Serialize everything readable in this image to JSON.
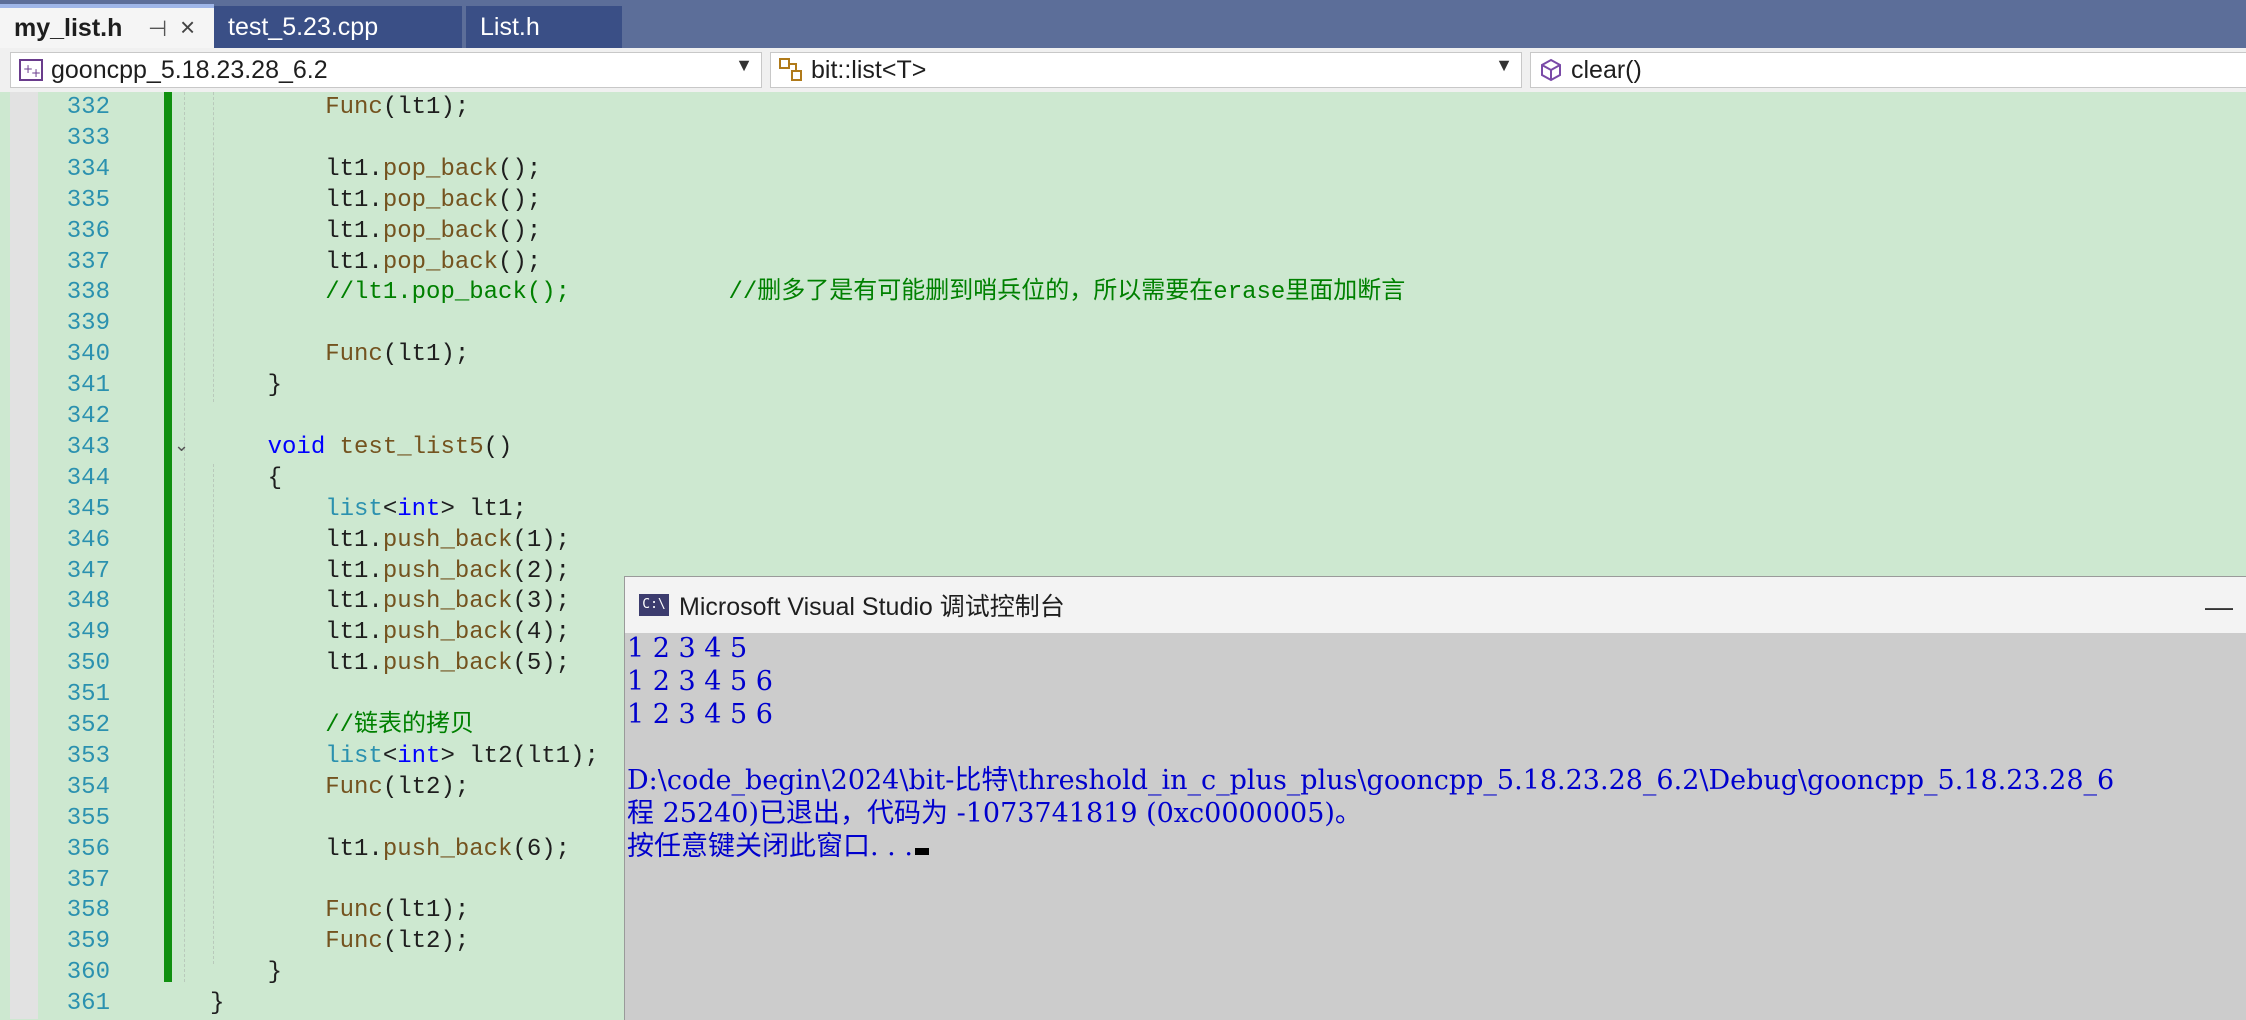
{
  "tabs": [
    {
      "label": "my_list.h",
      "active": true
    },
    {
      "label": "test_5.23.cpp",
      "active": false
    },
    {
      "label": "List.h",
      "active": false
    }
  ],
  "tab_icons": {
    "pin": "pin-icon",
    "close": "close-icon"
  },
  "navbar": {
    "project": "gooncpp_5.18.23.28_6.2",
    "scope": "bit::list<T>",
    "member": "clear()"
  },
  "editor": {
    "lines": [
      {
        "n": "332",
        "t": [
          [
            "        ",
            ""
          ],
          [
            "Func",
            "fn"
          ],
          [
            "(lt1);",
            ""
          ]
        ]
      },
      {
        "n": "333",
        "t": []
      },
      {
        "n": "334",
        "t": [
          [
            "        lt1.",
            ""
          ],
          [
            "pop_back",
            "fn"
          ],
          [
            "();",
            ""
          ]
        ]
      },
      {
        "n": "335",
        "t": [
          [
            "        lt1.",
            ""
          ],
          [
            "pop_back",
            "fn"
          ],
          [
            "();",
            ""
          ]
        ]
      },
      {
        "n": "336",
        "t": [
          [
            "        lt1.",
            ""
          ],
          [
            "pop_back",
            "fn"
          ],
          [
            "();",
            ""
          ]
        ]
      },
      {
        "n": "337",
        "t": [
          [
            "        lt1.",
            ""
          ],
          [
            "pop_back",
            "fn"
          ],
          [
            "();",
            ""
          ]
        ]
      },
      {
        "n": "338",
        "t": [
          [
            "        ",
            ""
          ],
          [
            "//lt1.pop_back();           //删多了是有可能删到哨兵位的，所以需要在erase里面加断言",
            "cm"
          ]
        ]
      },
      {
        "n": "339",
        "t": []
      },
      {
        "n": "340",
        "t": [
          [
            "        ",
            ""
          ],
          [
            "Func",
            "fn"
          ],
          [
            "(lt1);",
            ""
          ]
        ]
      },
      {
        "n": "341",
        "t": [
          [
            "    }",
            ""
          ]
        ]
      },
      {
        "n": "342",
        "t": []
      },
      {
        "n": "343",
        "t": [
          [
            "    ",
            ""
          ],
          [
            "void",
            "kw"
          ],
          [
            " ",
            ""
          ],
          [
            "test_list5",
            "fn"
          ],
          [
            "()",
            ""
          ]
        ]
      },
      {
        "n": "344",
        "t": [
          [
            "    {",
            ""
          ]
        ]
      },
      {
        "n": "345",
        "t": [
          [
            "        ",
            ""
          ],
          [
            "list",
            "ty"
          ],
          [
            "<",
            ""
          ],
          [
            "int",
            "kw"
          ],
          [
            "> lt1;",
            ""
          ]
        ]
      },
      {
        "n": "346",
        "t": [
          [
            "        lt1.",
            ""
          ],
          [
            "push_back",
            "fn"
          ],
          [
            "(1);",
            ""
          ]
        ]
      },
      {
        "n": "347",
        "t": [
          [
            "        lt1.",
            ""
          ],
          [
            "push_back",
            "fn"
          ],
          [
            "(2);",
            ""
          ]
        ]
      },
      {
        "n": "348",
        "t": [
          [
            "        lt1.",
            ""
          ],
          [
            "push_back",
            "fn"
          ],
          [
            "(3);",
            ""
          ]
        ]
      },
      {
        "n": "349",
        "t": [
          [
            "        lt1.",
            ""
          ],
          [
            "push_back",
            "fn"
          ],
          [
            "(4);",
            ""
          ]
        ]
      },
      {
        "n": "350",
        "t": [
          [
            "        lt1.",
            ""
          ],
          [
            "push_back",
            "fn"
          ],
          [
            "(5);",
            ""
          ]
        ]
      },
      {
        "n": "351",
        "t": []
      },
      {
        "n": "352",
        "t": [
          [
            "        ",
            ""
          ],
          [
            "//链表的拷贝",
            "cm"
          ]
        ]
      },
      {
        "n": "353",
        "t": [
          [
            "        ",
            ""
          ],
          [
            "list",
            "ty"
          ],
          [
            "<",
            ""
          ],
          [
            "int",
            "kw"
          ],
          [
            "> lt2(lt1);",
            ""
          ]
        ]
      },
      {
        "n": "354",
        "t": [
          [
            "        ",
            ""
          ],
          [
            "Func",
            "fn"
          ],
          [
            "(lt2);",
            ""
          ]
        ]
      },
      {
        "n": "355",
        "t": []
      },
      {
        "n": "356",
        "t": [
          [
            "        lt1.",
            ""
          ],
          [
            "push_back",
            "fn"
          ],
          [
            "(6);",
            ""
          ]
        ]
      },
      {
        "n": "357",
        "t": []
      },
      {
        "n": "358",
        "t": [
          [
            "        ",
            ""
          ],
          [
            "Func",
            "fn"
          ],
          [
            "(lt1);",
            ""
          ]
        ]
      },
      {
        "n": "359",
        "t": [
          [
            "        ",
            ""
          ],
          [
            "Func",
            "fn"
          ],
          [
            "(lt2);",
            ""
          ]
        ]
      },
      {
        "n": "360",
        "t": [
          [
            "    }",
            ""
          ]
        ]
      },
      {
        "n": "361",
        "t": [
          [
            "}",
            ""
          ]
        ]
      }
    ]
  },
  "console": {
    "title": "Microsoft Visual Studio 调试控制台",
    "icon_label": "C:\\",
    "output": [
      "1 2 3 4 5",
      "1 2 3 4 5 6",
      "1 2 3 4 5 6",
      "",
      "D:\\code_begin\\2024\\bit-比特\\threshold_in_c_plus_plus\\gooncpp_5.18.23.28_6.2\\Debug\\gooncpp_5.18.23.28_6",
      "程 25240)已退出，代码为 -1073741819 (0xc0000005)。",
      "按任意键关闭此窗口. . ."
    ]
  },
  "colors": {
    "editor_bg": "#cde8d0",
    "tabstrip_bg": "#5c6e99",
    "change_bar": "#109010",
    "console_text": "#0000cd",
    "line_number": "#2b91af"
  }
}
